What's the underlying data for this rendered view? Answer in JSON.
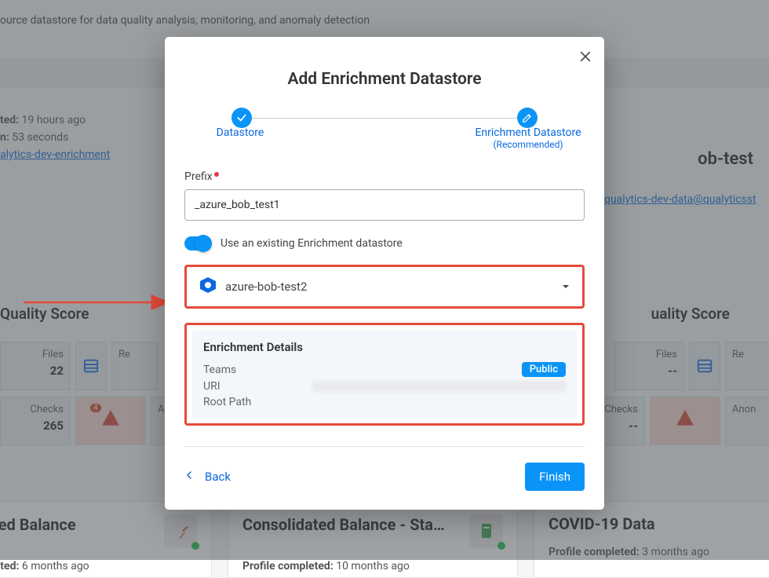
{
  "bg": {
    "top_desc": "ource datastore for data quality analysis, monitoring, and anomaly detection",
    "completed_label": "ted:",
    "completed_val": " 19 hours ago",
    "duration_label": "n:",
    "duration_val": " 53 seconds",
    "enrich_link": "alytics-dev-enrichment",
    "title_right": "ob-test",
    "link_right": "qualytics-dev-data@qualyticsst",
    "quality_left": "Quality Score",
    "quality_right": "uality Score",
    "card_files": "Files",
    "card_files_val": "22",
    "card_files_r": "Files",
    "card_files_r_val": "--",
    "card_r_lbl": "Re",
    "card_checks": "Checks",
    "card_checks_val": "265",
    "card_checks_r": "Checks",
    "card_checks_r_val": "--",
    "card_anom": "Ano",
    "card_anom_r": "Anon",
    "card_badge": "4",
    "bcard1_title": "dated Balance",
    "bcard1_sub": "mpleted: ",
    "bcard1_sub_val": "6 months ago",
    "bcard2_title": "Consolidated Balance - Sta…",
    "bcard3_title": "COVID-19 Data",
    "bcard3_sub": "Profile completed: ",
    "bcard3_sub_val": "3 months ago",
    "bcard2_sub": "Profile completed: ",
    "bcard2_sub_val": "10 months ago"
  },
  "modal": {
    "title": "Add Enrichment Datastore",
    "step1": "Datastore",
    "step2": "Enrichment Datastore",
    "step2_sub": "(Recommended)",
    "prefix_label": "Prefix",
    "prefix_value": "_azure_bob_test1",
    "toggle_label": "Use an existing Enrichment datastore",
    "select_value": "azure-bob-test2",
    "details_title": "Enrichment Details",
    "details_teams": "Teams",
    "details_public": "Public",
    "details_uri": "URI",
    "details_root": "Root Path",
    "back": "Back",
    "finish": "Finish"
  }
}
